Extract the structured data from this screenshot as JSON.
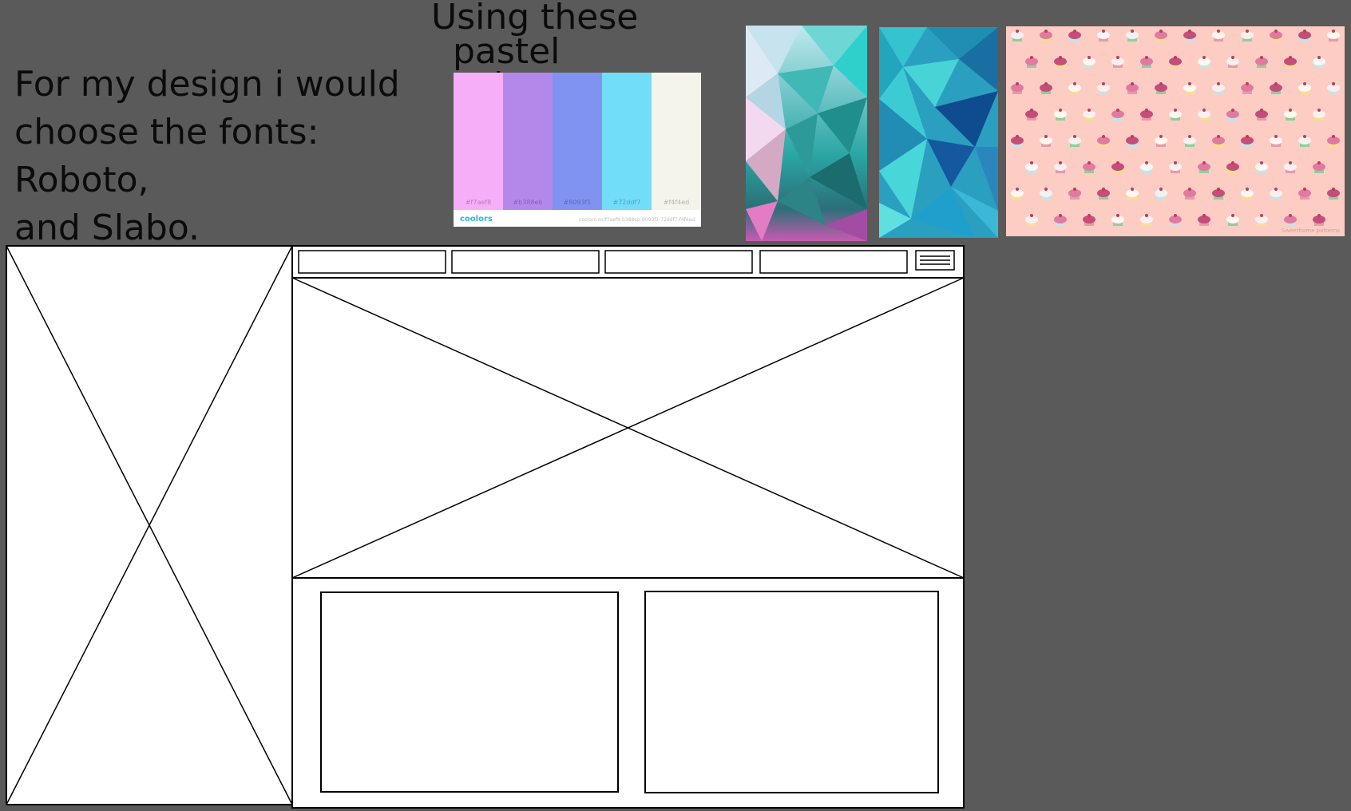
{
  "intro": {
    "lines": [
      "For my design i would",
      "choose the fonts: Roboto,",
      "and Slabo."
    ]
  },
  "palette": {
    "heading_line1": "Using these",
    "heading_line2": "pastel colours",
    "swatches": [
      {
        "hex": "#f7aef8",
        "label": "#f7aef8"
      },
      {
        "hex": "#b388eb",
        "label": "#b388eb"
      },
      {
        "hex": "#8093f1",
        "label": "#8093f1"
      },
      {
        "hex": "#72ddf7",
        "label": "#72ddf7"
      },
      {
        "hex": "#f4f4ed",
        "label": "#f4f4ed"
      }
    ],
    "brand": "coolors",
    "url": "coolors.co/f7aef8-b388eb-8093f1-72ddf7-f4f4ed"
  },
  "reference_images": [
    {
      "name": "pastel-low-poly-image",
      "colors": [
        "#d6e6f2",
        "#2fc9c4",
        "#1f7f7c",
        "#d09abf",
        "#e86fbd"
      ]
    },
    {
      "name": "teal-low-poly-image",
      "colors": [
        "#2bb4c4",
        "#1a6fa2",
        "#0e3f86",
        "#38d0d3"
      ]
    },
    {
      "name": "cupcake-pattern-image",
      "background": "#fdcdc4",
      "caption": "Sweethome patterns"
    }
  ],
  "wireframe": {
    "nav_slot_count": 4,
    "has_hamburger_menu": true,
    "content_boxes": 2
  }
}
